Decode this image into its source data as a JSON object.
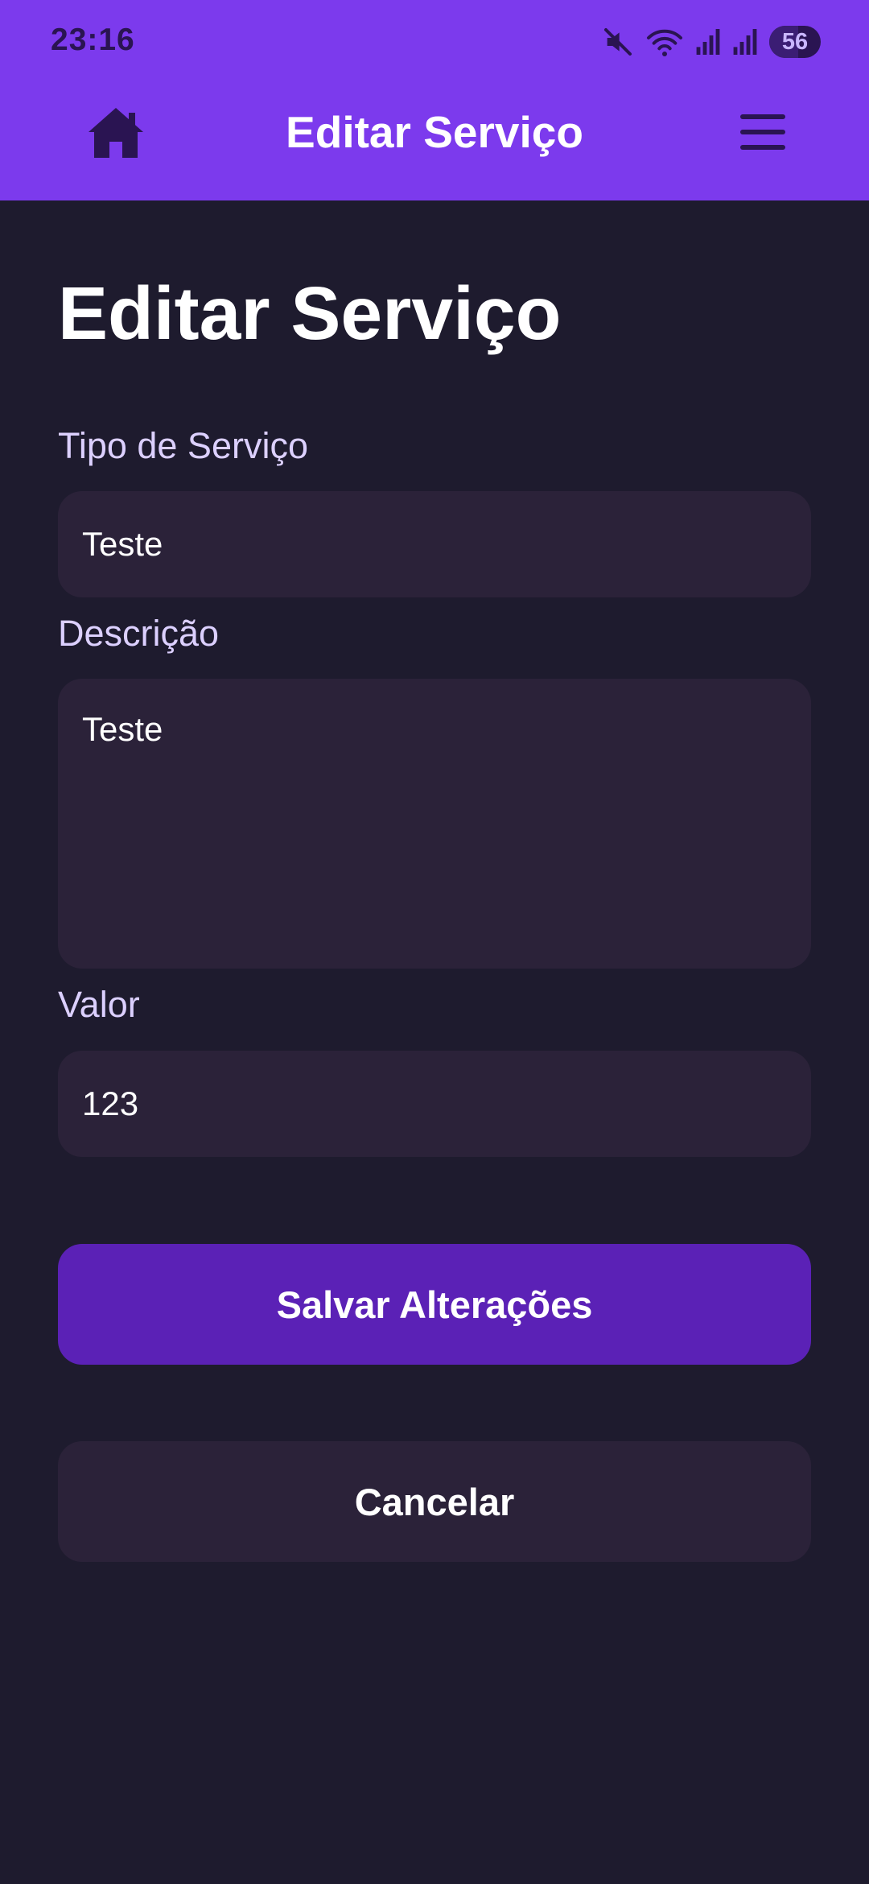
{
  "status_bar": {
    "time": "23:16",
    "battery_percent": "56",
    "icons": [
      "mute-icon",
      "wifi-icon",
      "signal-icon",
      "signal-icon"
    ]
  },
  "app_bar": {
    "title": "Editar Serviço",
    "left_icon": "home-icon",
    "right_icon": "hamburger-menu-icon"
  },
  "page": {
    "title": "Editar Serviço"
  },
  "form": {
    "service_type": {
      "label": "Tipo de Serviço",
      "value": "Teste"
    },
    "description": {
      "label": "Descrição",
      "value": "Teste"
    },
    "price": {
      "label": "Valor",
      "value": "123"
    }
  },
  "actions": {
    "save_label": "Salvar Alterações",
    "cancel_label": "Cancelar"
  },
  "colors": {
    "header": "#7c3aed",
    "background": "#1e1b2e",
    "field_background": "#2b2239",
    "primary_button": "#5b21b6"
  }
}
